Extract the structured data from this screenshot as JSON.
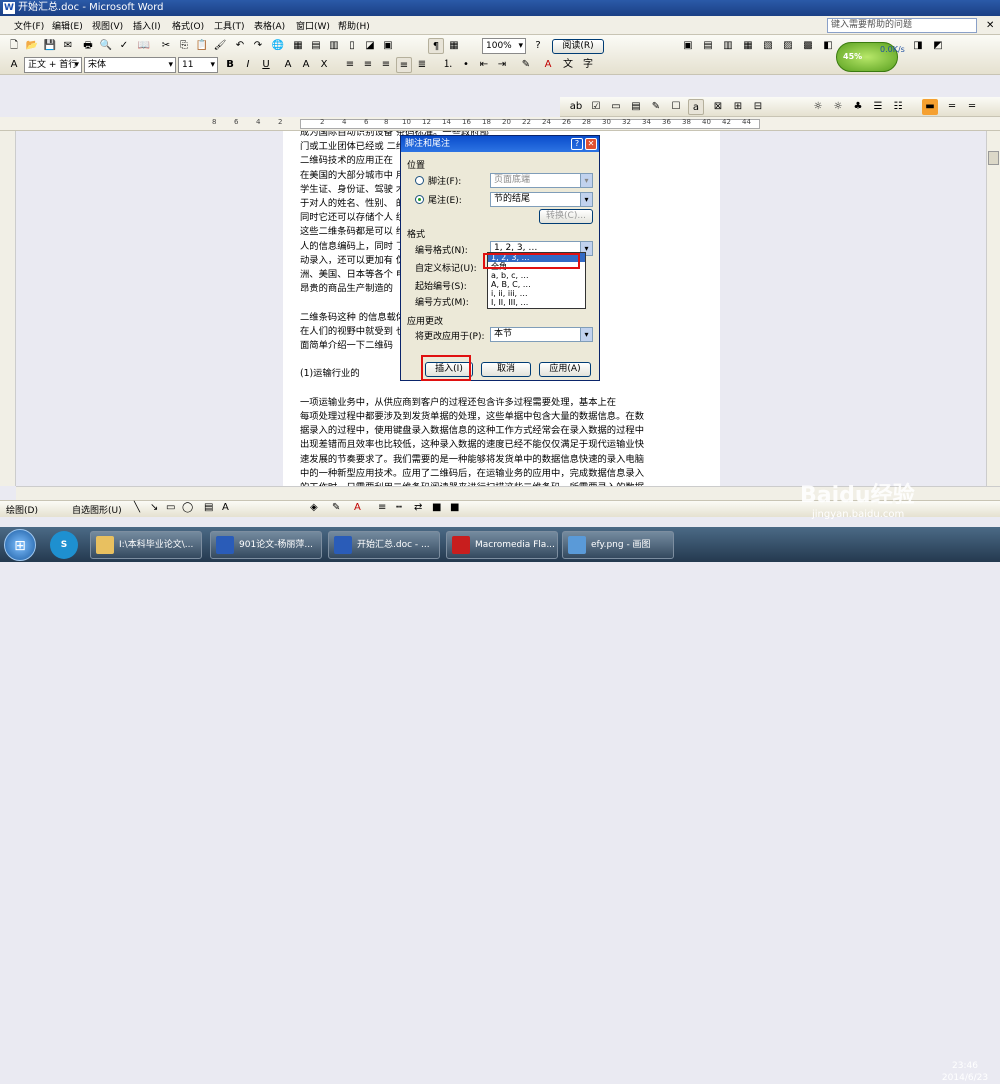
{
  "window": {
    "title": "开始汇总.doc - Microsoft Word",
    "help_box": "键入需要帮助的问题"
  },
  "menu": [
    "文件(F)",
    "编辑(E)",
    "视图(V)",
    "插入(I)",
    "格式(O)",
    "工具(T)",
    "表格(A)",
    "窗口(W)",
    "帮助(H)"
  ],
  "toolbar": {
    "zoom": "100%",
    "reading": "阅读(R)",
    "style": "正文 + 首行",
    "font": "宋体",
    "size": "11"
  },
  "weather": {
    "cpu": "45%",
    "speed": "0.0K/s"
  },
  "ruler": {
    "ticks": [
      "8",
      "6",
      "4",
      "2",
      "2",
      "4",
      "6",
      "8",
      "10",
      "12",
      "14",
      "16",
      "18",
      "20",
      "22",
      "24",
      "26",
      "28",
      "30",
      "32",
      "34",
      "36",
      "38",
      "40",
      "42",
      "44"
    ]
  },
  "document": {
    "lines": [
      "成为国际自动识别设备                                          条码标准。一些政府部",
      "门或工业团体已经或                                       二维条码技术，也可以说",
      "二维码技术的应用正在",
      "在美国的大部分城市中                                     用在了各种证件上例如",
      "学生证、身份证、驾驶                                     术。二维码不仅可以用",
      "于对人的姓名、性别、                                     的各种信息进行编码，",
      "同时它还可以存储个人                                     纹及照片等信息，并且",
      "这些二维条码都是可以                                     维码不仅可以应用在对",
      "人的信息编码上，同时                                     了对各人证件信息的自",
      "动录入，还可以更加有                                     伪行为的发生。在欧",
      "洲、美国、日本等各个                                     电子产品中等这些比较",
      "昂贵的商品生产制造的",
      "",
      "    二维条码这种                                         的信息载体，自从出现",
      "在人们的视野中就受到                                     也是难以想象的。下",
      "面简单介绍一下二维码",
      "",
      "        (1)运输行业的",
      "",
      "    一项运输业务中，从供应商到客户的过程还包含许多过程需要处理，基本上在",
      "每项处理过程中都要涉及到发货单据的处理，这些单据中包含大量的数据信息。在数",
      "据录入的过程中，使用键盘录入数据信息的这种工作方式经常会在录入数据的过程中",
      "出现差错而且效率也比较低，这种录入数据的速度已经不能仅仅满足于现代运输业快",
      "速发展的节奏要求了。我们需要的是一种能够将发货单中的数据信息快速的录入电脑",
      "中的一种新型应用技术。应用了二维码后，在运输业务的应用中，完成数据信息录入",
      "的工作时，只需要利用二维条码阅读器来进行扫描这些二维条码，所需要录入的数据"
    ]
  },
  "dialog": {
    "title": "脚注和尾注",
    "location_label": "位置",
    "footnote_label": "脚注(F):",
    "footnote_value": "页面底端",
    "endnote_label": "尾注(E):",
    "endnote_value": "节的结尾",
    "convert_button": "转换(C)...",
    "format_label": "格式",
    "number_format_label": "编号格式(N):",
    "number_format_value": "1, 2, 3, …",
    "custom_mark_label": "自定义标记(U):",
    "start_at_label": "起始编号(S):",
    "numbering_label": "编号方式(M):",
    "apply_changes_label": "应用更改",
    "apply_to_label": "将更改应用于(P):",
    "apply_to_value": "本节",
    "insert_button": "插入(I)",
    "cancel_button": "取消",
    "apply_button": "应用(A)",
    "dropdown_items": [
      "1, 2, 3, …",
      "全角",
      "a, b, c, …",
      "A, B, C, …",
      "i, ii, iii, …",
      "I, II, III, …"
    ]
  },
  "draw_toolbar": {
    "draw": "绘图(D)",
    "autoshapes": "自选图形(U)"
  },
  "taskbar": {
    "tasks": [
      {
        "label": "I:\\本科毕业论文\\...",
        "icon": "folder-icon",
        "color": "#e8c060"
      },
      {
        "label": "901论文-杨丽萍...",
        "icon": "word-icon",
        "color": "#2a5cb8"
      },
      {
        "label": "开始汇总.doc - ...",
        "icon": "word-icon",
        "color": "#2a5cb8"
      },
      {
        "label": "Macromedia Fla...",
        "icon": "flash-icon",
        "color": "#c81e1e"
      },
      {
        "label": "efy.png - 画图",
        "icon": "paint-icon",
        "color": "#5a9ad8"
      }
    ],
    "time": "23:46",
    "date": "2014/6/23"
  },
  "watermark": {
    "brand": "Baidu经验",
    "url": "jingyan.baidu.com"
  }
}
